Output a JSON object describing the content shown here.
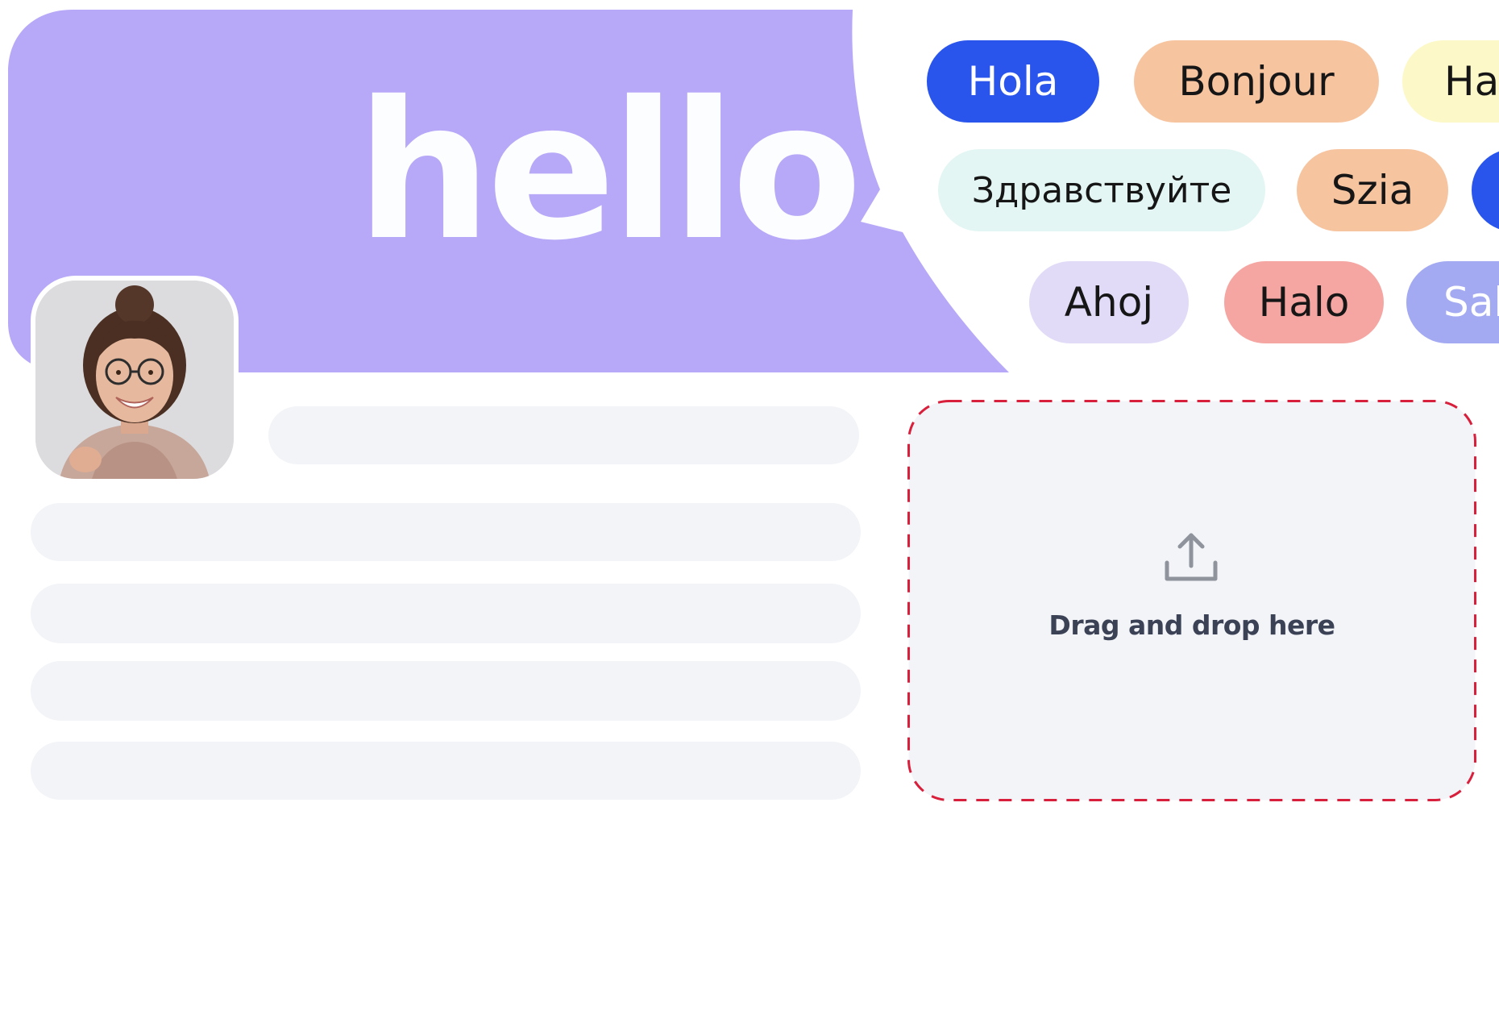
{
  "greeting": "hello",
  "chips": [
    {
      "label": "Hola",
      "bg": "#2a55ec",
      "fg": "#ffffff"
    },
    {
      "label": "Bonjour",
      "bg": "#f7c4a0",
      "fg": "#161616"
    },
    {
      "label": "Ha",
      "bg": "#fdf8c8",
      "fg": "#161616"
    },
    {
      "label": "Здравствуйте",
      "bg": "#e3f6f3",
      "fg": "#161616"
    },
    {
      "label": "Szia",
      "bg": "#f7c4a0",
      "fg": "#161616"
    },
    {
      "label": "",
      "bg": "#2a55ec",
      "fg": "#ffffff"
    },
    {
      "label": "Ahoj",
      "bg": "#e2dbf8",
      "fg": "#161616"
    },
    {
      "label": "Halo",
      "bg": "#f6a6a2",
      "fg": "#161616"
    },
    {
      "label": "Sal",
      "bg": "#a3aaf2",
      "fg": "#ffffff"
    }
  ],
  "dropzone": {
    "label": "Drag and drop here",
    "icon": "upload-icon",
    "border_color": "#d81f3c"
  },
  "colors": {
    "bubble": "#b8a8f8",
    "skeleton": "#f3f4f8",
    "dropzone_bg": "#f3f4f8"
  }
}
